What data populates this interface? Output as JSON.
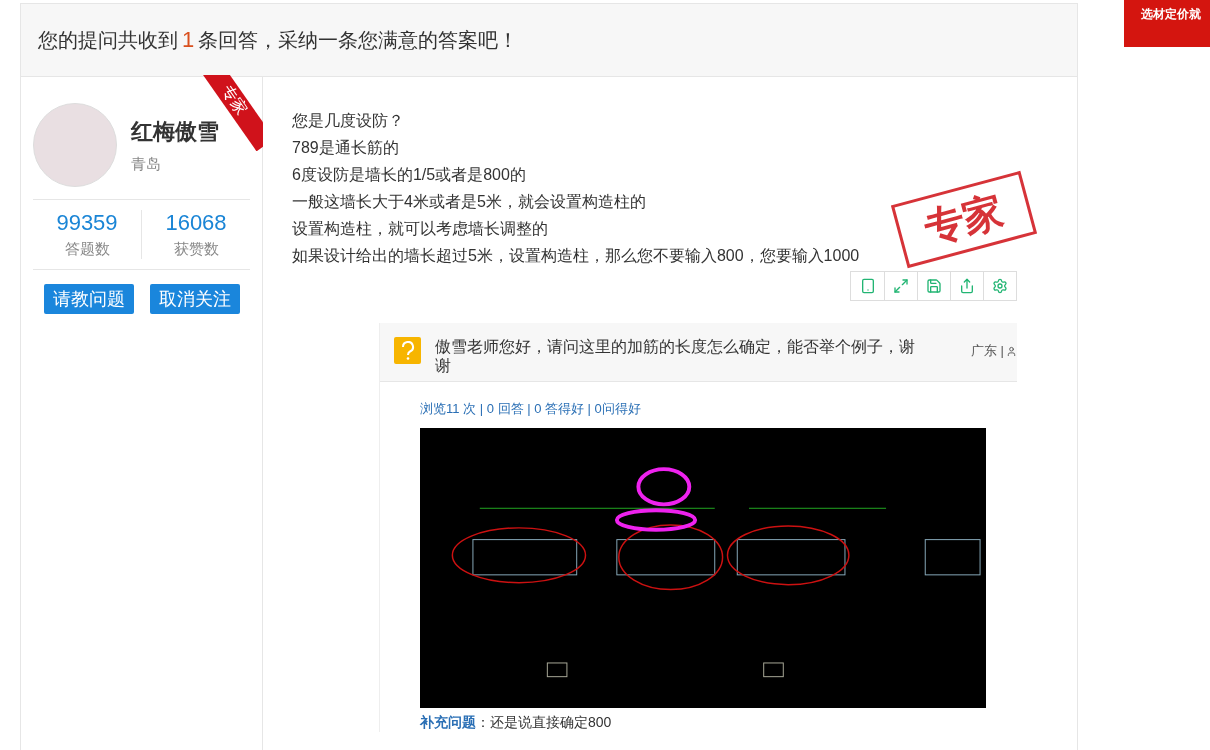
{
  "notice": {
    "prefix": "您的提问共收到",
    "count": "1",
    "suffix": "条回答，采纳一条您满意的答案吧！"
  },
  "expert": {
    "ribbon": "专家",
    "name": "红梅傲雪",
    "city": "青岛",
    "stats": [
      {
        "value": "99359",
        "label": "答题数"
      },
      {
        "value": "16068",
        "label": "获赞数"
      }
    ],
    "buttons": [
      "请教问题",
      "取消关注"
    ]
  },
  "answer": {
    "lines": [
      "您是几度设防？",
      "789是通长筋的",
      "6度设防是墙长的1/5或者是800的",
      "一般这墙长大于4米或者是5米，就会设置构造柱的",
      "设置构造柱，就可以考虑墙长调整的",
      "如果设计给出的墙长超过5米，设置构造柱，那么您不要输入800，您要输入1000"
    ],
    "stamp": "专家"
  },
  "question": {
    "title": "傲雪老师您好，请问这里的加筋的长度怎么确定，能否举个例子，谢谢",
    "meta": "广东 |",
    "stats": "浏览11 次 | 0 回答 | 0 答得好 | 0问得好",
    "supplement_label": "补充问题",
    "supplement_text": "：还是说直接确定800"
  },
  "ad": {
    "text": "选材定价就"
  }
}
